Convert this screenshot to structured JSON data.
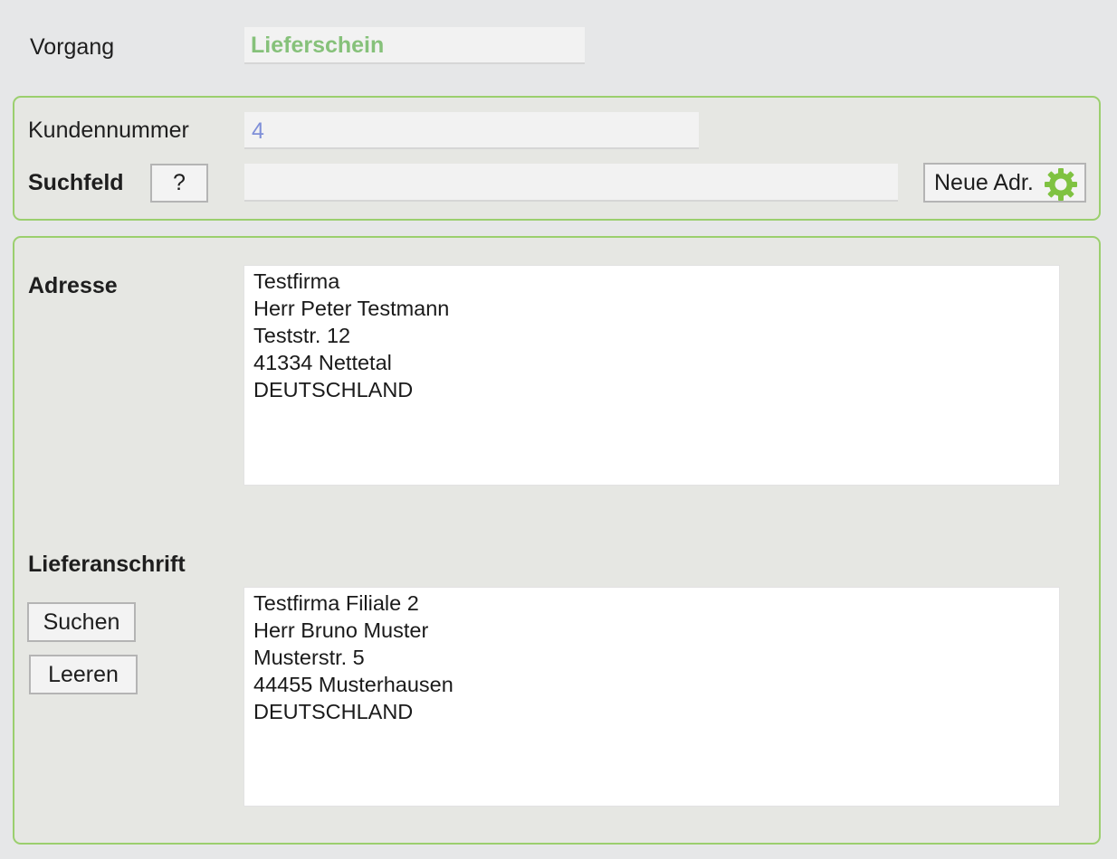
{
  "vorgang": {
    "label": "Vorgang",
    "value": "Lieferschein",
    "value_color": "#86c17a"
  },
  "customer": {
    "number_label": "Kundennummer",
    "number_value": "4",
    "number_color": "#7f8fd8",
    "search_label": "Suchfeld",
    "help_button": "?",
    "search_value": "",
    "new_address_button": "Neue Adr.",
    "new_address_icon": "gear-icon",
    "accent": "#7fc241"
  },
  "address": {
    "label": "Adresse",
    "lines": [
      "Testfirma",
      "Herr Peter Testmann",
      "Teststr. 12",
      "41334 Nettetal",
      "DEUTSCHLAND"
    ]
  },
  "delivery": {
    "label": "Lieferanschrift",
    "search_button": "Suchen",
    "clear_button": "Leeren",
    "lines": [
      "Testfirma Filiale 2",
      "Herr Bruno Muster",
      "Musterstr. 5",
      "44455 Musterhausen",
      "DEUTSCHLAND"
    ]
  }
}
